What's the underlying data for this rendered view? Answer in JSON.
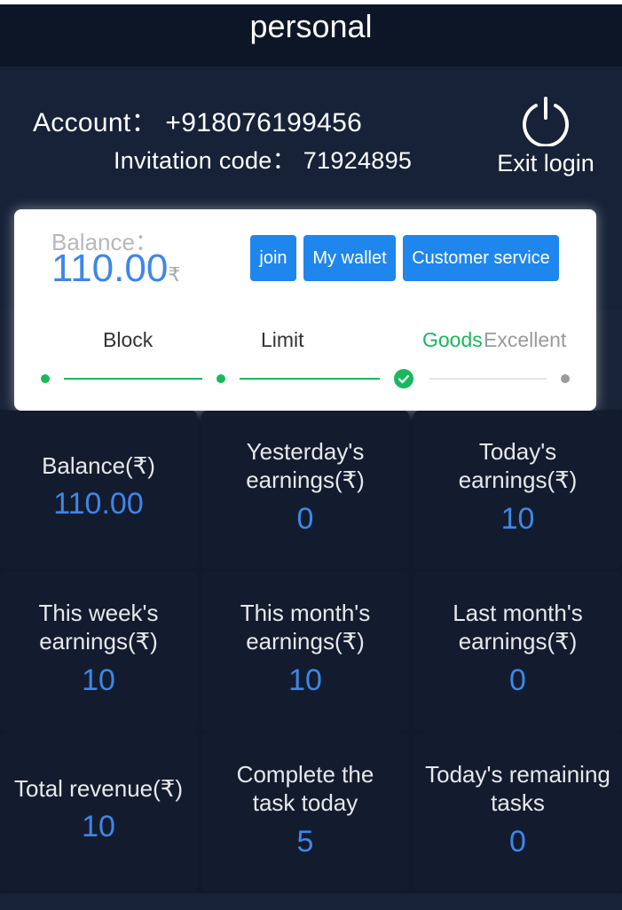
{
  "header": {
    "title": "personal"
  },
  "profile": {
    "account": "Account： +918076199456",
    "invitation": "Invitation code： 71924895",
    "exit_label": "Exit login"
  },
  "card": {
    "balance_label": "Balance：",
    "balance_value": "110.00",
    "balance_unit": "₹",
    "buttons": {
      "join": "join",
      "wallet": "My wallet",
      "service": "Customer service"
    },
    "levels": [
      "Block",
      "Limit",
      "Goods",
      "Excellent"
    ],
    "current_level": "Goods",
    "colors": {
      "active": "#19b85c",
      "inactive": "#9a9a9a",
      "button": "#1f86ee"
    }
  },
  "stats": [
    {
      "label": "Balance(₹)",
      "value": "110.00"
    },
    {
      "label": "Yesterday's earnings(₹)",
      "value": "0"
    },
    {
      "label": "Today's earnings(₹)",
      "value": "10"
    },
    {
      "label": "This week's earnings(₹)",
      "value": "10"
    },
    {
      "label": "This month's earnings(₹)",
      "value": "10"
    },
    {
      "label": "Last month's earnings(₹)",
      "value": "0"
    },
    {
      "label": "Total revenue(₹)",
      "value": "10"
    },
    {
      "label": "Complete the task today",
      "value": "5"
    },
    {
      "label": "Today's remaining tasks",
      "value": "0"
    }
  ]
}
